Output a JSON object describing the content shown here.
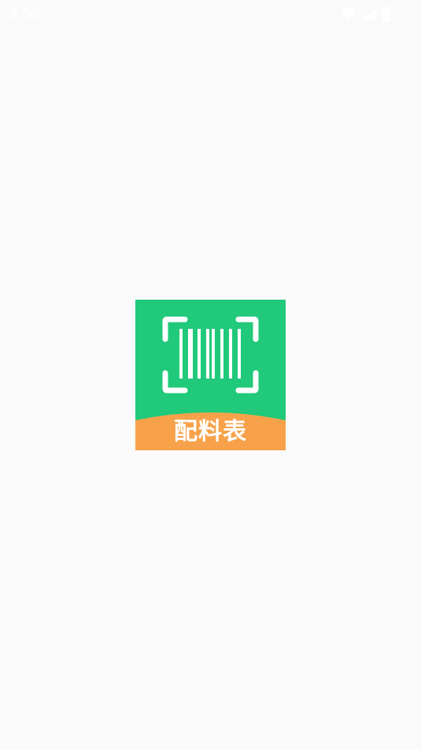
{
  "status_bar": {
    "time": "9:52",
    "icons": [
      "wifi-icon",
      "cell-signal-icon",
      "battery-icon"
    ]
  },
  "splash": {
    "app_icon": {
      "label": "配料表",
      "icon": "barcode-scan-icon",
      "colors": {
        "top": "#21c97a",
        "bottom": "#f7a24a",
        "foreground": "#ffffff"
      }
    }
  },
  "colors": {
    "background": "#fafafa"
  }
}
